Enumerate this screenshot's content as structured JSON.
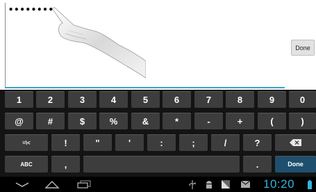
{
  "field": {
    "password_value": "••••••••"
  },
  "top_done_label": "Done",
  "keyboard": {
    "row1": [
      "1",
      "2",
      "3",
      "4",
      "5",
      "6",
      "7",
      "8",
      "9",
      "0"
    ],
    "row2": [
      "@",
      "#",
      "$",
      "%",
      "&",
      "*",
      "-",
      "+",
      "(",
      ")"
    ],
    "row3": [
      "=\\<",
      "!",
      "\"",
      "'",
      ":",
      ";",
      "/",
      "?"
    ],
    "row4": {
      "abc": "ABC",
      "comma": ",",
      "period": ".",
      "done": "Done"
    }
  },
  "status": {
    "time": "10:20"
  },
  "icons": {
    "backspace": "backspace-icon",
    "back": "back-icon",
    "home": "home-icon",
    "recents": "recent-apps-icon",
    "usb": "usb-icon",
    "android": "android-debug-icon",
    "signal": "signal-icon",
    "mail": "email-icon",
    "battery": "battery-icon"
  },
  "colors": {
    "accent": "#35b2e0",
    "keyboard_bg": "#141414",
    "key_bg": "#3d3d3d",
    "done_key_bg": "#1e4f6e"
  }
}
